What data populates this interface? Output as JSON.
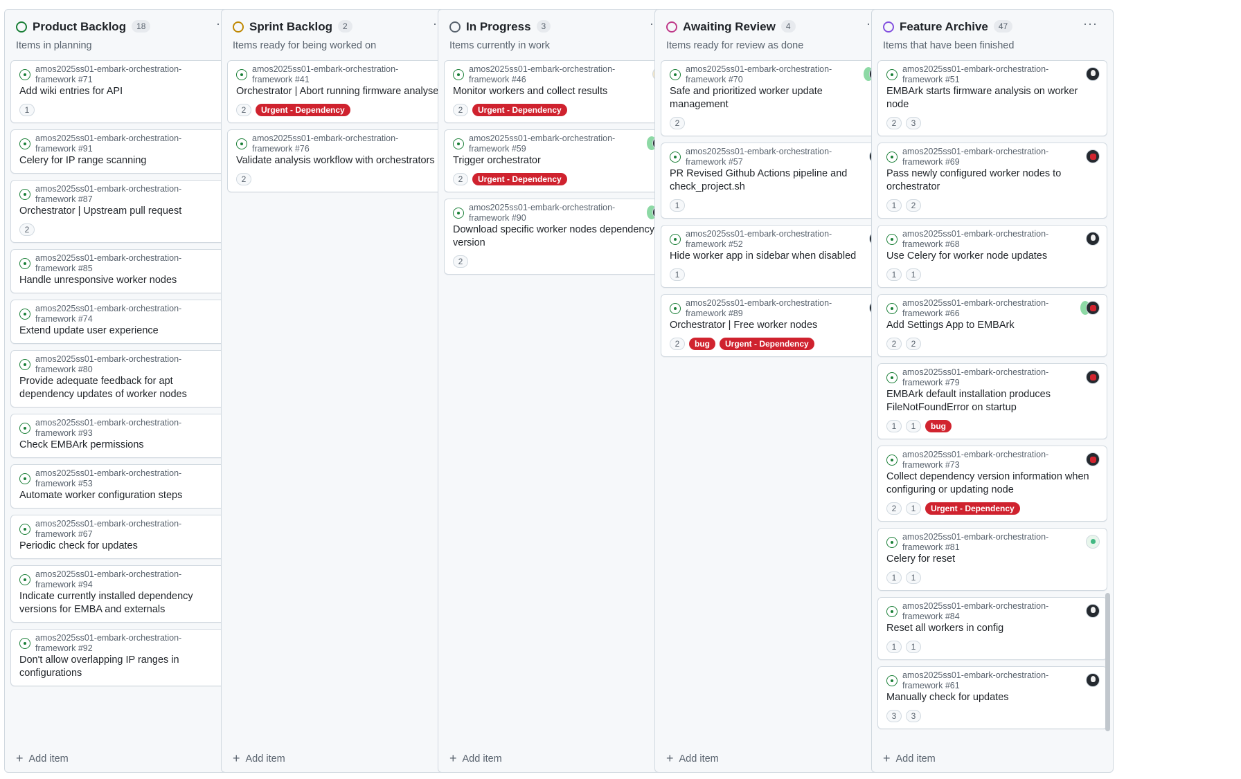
{
  "columns": [
    {
      "title": "Product Backlog",
      "count": "18",
      "description": "Items in planning",
      "status_color": "#1a7f37",
      "menu": "···",
      "add_item": "Add item",
      "cards": [
        {
          "ref": "amos2025ss01-embark-orchestration-framework #71",
          "title": "Add wiki entries for API",
          "pills": [
            "1"
          ],
          "labels": [],
          "avatar": ""
        },
        {
          "ref": "amos2025ss01-embark-orchestration-framework #91",
          "title": "Celery for IP range scanning",
          "pills": [],
          "labels": [],
          "avatar": ""
        },
        {
          "ref": "amos2025ss01-embark-orchestration-framework #87",
          "title": "Orchestrator | Upstream pull request",
          "pills": [
            "2"
          ],
          "labels": [],
          "avatar": ""
        },
        {
          "ref": "amos2025ss01-embark-orchestration-framework #85",
          "title": "Handle unresponsive worker nodes",
          "pills": [],
          "labels": [],
          "avatar": ""
        },
        {
          "ref": "amos2025ss01-embark-orchestration-framework #74",
          "title": "Extend update user experience",
          "pills": [],
          "labels": [],
          "avatar": ""
        },
        {
          "ref": "amos2025ss01-embark-orchestration-framework #80",
          "title": "Provide adequate feedback for apt dependency updates of worker nodes",
          "pills": [],
          "labels": [],
          "avatar": ""
        },
        {
          "ref": "amos2025ss01-embark-orchestration-framework #93",
          "title": "Check EMBArk permissions",
          "pills": [],
          "labels": [],
          "avatar": ""
        },
        {
          "ref": "amos2025ss01-embark-orchestration-framework #53",
          "title": "Automate worker configuration steps",
          "pills": [],
          "labels": [],
          "avatar": ""
        },
        {
          "ref": "amos2025ss01-embark-orchestration-framework #67",
          "title": "Periodic check for updates",
          "pills": [],
          "labels": [],
          "avatar": ""
        },
        {
          "ref": "amos2025ss01-embark-orchestration-framework #94",
          "title": "Indicate currently installed dependency versions for EMBA and externals",
          "pills": [],
          "labels": [],
          "avatar": ""
        },
        {
          "ref": "amos2025ss01-embark-orchestration-framework #92",
          "title": "Don't allow overlapping IP ranges in configurations",
          "pills": [],
          "labels": [],
          "avatar": ""
        }
      ]
    },
    {
      "title": "Sprint Backlog",
      "count": "2",
      "description": "Items ready for being worked on",
      "status_color": "#bf8700",
      "menu": "···",
      "add_item": "Add item",
      "cards": [
        {
          "ref": "amos2025ss01-embark-orchestration-framework #41",
          "title": "Orchestrator | Abort running firmware analyses",
          "pills": [
            "2"
          ],
          "labels": [
            "Urgent - Dependency"
          ],
          "avatar": ""
        },
        {
          "ref": "amos2025ss01-embark-orchestration-framework #76",
          "title": "Validate analysis workflow with orchestrators",
          "pills": [
            "2"
          ],
          "labels": [],
          "avatar": ""
        }
      ]
    },
    {
      "title": "In Progress",
      "count": "3",
      "description": "Items currently in work",
      "status_color": "#59636e",
      "menu": "···",
      "add_item": "Add item",
      "cards": [
        {
          "ref": "amos2025ss01-embark-orchestration-framework #46",
          "title": "Monitor workers and collect results",
          "pills": [
            "2"
          ],
          "labels": [
            "Urgent - Dependency"
          ],
          "avatar": "tan"
        },
        {
          "ref": "amos2025ss01-embark-orchestration-framework #59",
          "title": "Trigger orchestrator",
          "pills": [
            "2"
          ],
          "labels": [
            "Urgent - Dependency"
          ],
          "avatar": "red-double"
        },
        {
          "ref": "amos2025ss01-embark-orchestration-framework #90",
          "title": "Download specific worker nodes dependency version",
          "pills": [
            "2"
          ],
          "labels": [],
          "avatar": "dark-double"
        }
      ]
    },
    {
      "title": "Awaiting Review",
      "count": "4",
      "description": "Items ready for review as done",
      "status_color": "#bf3989",
      "menu": "···",
      "add_item": "Add item",
      "cards": [
        {
          "ref": "amos2025ss01-embark-orchestration-framework #70",
          "title": "Safe and prioritized worker update management",
          "pills": [
            "2"
          ],
          "labels": [],
          "avatar": "dark-double"
        },
        {
          "ref": "amos2025ss01-embark-orchestration-framework #57",
          "title": "PR Revised Github Actions pipeline and check_project.sh",
          "pills": [
            "1"
          ],
          "labels": [],
          "avatar": "dark"
        },
        {
          "ref": "amos2025ss01-embark-orchestration-framework #52",
          "title": "Hide worker app in sidebar when disabled",
          "pills": [
            "1"
          ],
          "labels": [],
          "avatar": "red"
        },
        {
          "ref": "amos2025ss01-embark-orchestration-framework #89",
          "title": "Orchestrator | Free worker nodes",
          "pills": [
            "2"
          ],
          "labels": [
            "bug",
            "Urgent - Dependency"
          ],
          "avatar": "red"
        }
      ]
    },
    {
      "title": "Feature Archive",
      "count": "47",
      "description": "Items that have been finished",
      "status_color": "#8250df",
      "menu": "···",
      "add_item": "Add item",
      "cards": [
        {
          "ref": "amos2025ss01-embark-orchestration-framework #51",
          "title": "EMBArk starts firmware analysis on worker node",
          "pills": [
            "2",
            "3"
          ],
          "labels": [],
          "avatar": "dark"
        },
        {
          "ref": "amos2025ss01-embark-orchestration-framework #69",
          "title": "Pass newly configured worker nodes to orchestrator",
          "pills": [
            "1",
            "2"
          ],
          "labels": [],
          "avatar": "red"
        },
        {
          "ref": "amos2025ss01-embark-orchestration-framework #68",
          "title": "Use Celery for worker node updates",
          "pills": [
            "1",
            "1"
          ],
          "labels": [],
          "avatar": "dark"
        },
        {
          "ref": "amos2025ss01-embark-orchestration-framework #66",
          "title": "Add Settings App to EMBArk",
          "pills": [
            "2",
            "2"
          ],
          "labels": [],
          "avatar": "red-double"
        },
        {
          "ref": "amos2025ss01-embark-orchestration-framework #79",
          "title": "EMBArk default installation produces FileNotFoundError on startup",
          "pills": [
            "1",
            "1"
          ],
          "labels": [
            "bug"
          ],
          "avatar": "red"
        },
        {
          "ref": "amos2025ss01-embark-orchestration-framework #73",
          "title": "Collect dependency version information when configuring or updating node",
          "pills": [
            "2",
            "1"
          ],
          "labels": [
            "Urgent - Dependency"
          ],
          "avatar": "red"
        },
        {
          "ref": "amos2025ss01-embark-orchestration-framework #81",
          "title": "Celery for reset",
          "pills": [
            "1",
            "1"
          ],
          "labels": [],
          "avatar": "green"
        },
        {
          "ref": "amos2025ss01-embark-orchestration-framework #84",
          "title": "Reset all workers in config",
          "pills": [
            "1",
            "1"
          ],
          "labels": [],
          "avatar": "dark"
        },
        {
          "ref": "amos2025ss01-embark-orchestration-framework #61",
          "title": "Manually check for updates",
          "pills": [
            "3",
            "3"
          ],
          "labels": [],
          "avatar": "dark"
        }
      ]
    }
  ]
}
